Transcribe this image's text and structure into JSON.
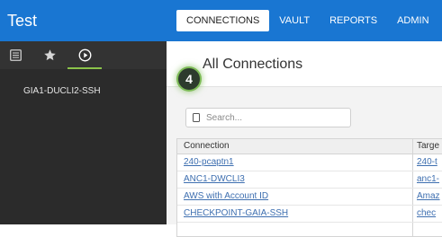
{
  "app": {
    "title": "Test"
  },
  "nav": {
    "items": [
      {
        "label": "CONNECTIONS",
        "active": true
      },
      {
        "label": "VAULT",
        "active": false
      },
      {
        "label": "REPORTS",
        "active": false
      },
      {
        "label": "ADMIN",
        "active": false
      }
    ]
  },
  "sidebar": {
    "tabs": [
      {
        "icon": "list-icon"
      },
      {
        "icon": "star-icon"
      },
      {
        "icon": "play-circle-icon",
        "active": true
      }
    ],
    "items": [
      {
        "label": "GIA1-DUCLI2-SSH"
      }
    ]
  },
  "main": {
    "title": "All Connections",
    "step_badge": "4",
    "search": {
      "placeholder": "Search...",
      "value": ""
    },
    "table": {
      "columns": [
        "Connection",
        "Targe"
      ],
      "rows": [
        {
          "connection": "240-pcaptn1",
          "target": "240-t"
        },
        {
          "connection": "ANC1-DWCLI3",
          "target": "anc1-"
        },
        {
          "connection": "AWS with Account ID",
          "target": "Amaz"
        },
        {
          "connection": "CHECKPOINT-GAIA-SSH",
          "target": "chec"
        }
      ]
    }
  },
  "colors": {
    "topbar": "#1976d2",
    "sidebar": "#2b2b2b",
    "accent_green": "#8bc34a",
    "link": "#3e6fb0"
  }
}
